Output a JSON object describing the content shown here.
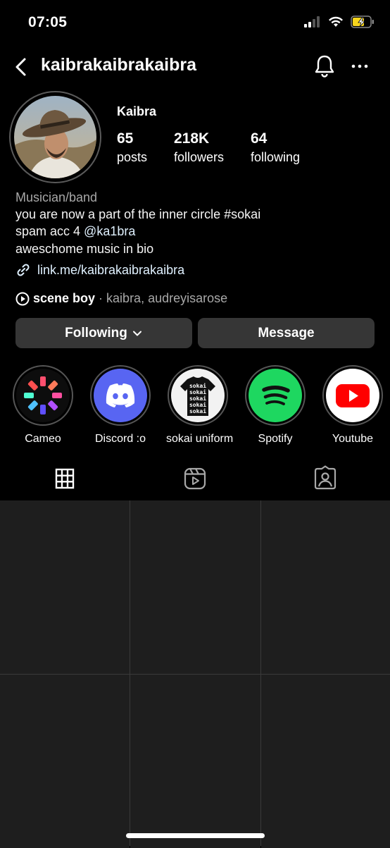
{
  "status_bar": {
    "time": "07:05"
  },
  "header": {
    "username": "kaibrakaibrakaibra"
  },
  "profile": {
    "display_name": "Kaibra",
    "stats": [
      {
        "value": "65",
        "label": "posts"
      },
      {
        "value": "218K",
        "label": "followers"
      },
      {
        "value": "64",
        "label": "following"
      }
    ],
    "category": "Musician/band",
    "bio_line1": "you are now a part of the inner circle #sokai",
    "bio_line2_prefix": "spam acc 4 ",
    "bio_line2_mention": "@ka1bra",
    "bio_line3": "aweschome music in bio",
    "link": "link.me/kaibrakaibrakaibra",
    "music": {
      "song": "scene boy",
      "artists": " · kaibra, audreyisarose"
    }
  },
  "actions": {
    "following_label": "Following",
    "message_label": "Message"
  },
  "highlights": [
    {
      "label": "Cameo",
      "icon": "cameo-icon"
    },
    {
      "label": "Discord :o",
      "icon": "discord-icon"
    },
    {
      "label": "sokai uniform",
      "icon": "sokai-shirt-icon"
    },
    {
      "label": "Spotify",
      "icon": "spotify-icon"
    },
    {
      "label": "Youtube",
      "icon": "youtube-icon"
    }
  ],
  "sokai_shirt_text": "sokai",
  "tabs": [
    {
      "name": "grid",
      "icon": "grid-icon",
      "active": true
    },
    {
      "name": "reels",
      "icon": "reels-icon",
      "active": false
    },
    {
      "name": "tagged",
      "icon": "tagged-icon",
      "active": false
    }
  ],
  "colors": {
    "background": "#000000",
    "button_bg": "#363636",
    "secondary_text": "#a8a8a8",
    "link_text": "#e0f1ff",
    "battery_fill": "#f7d51d",
    "spotify_green": "#1ed760",
    "discord_blurple": "#5865f2",
    "youtube_red": "#ff0000"
  }
}
